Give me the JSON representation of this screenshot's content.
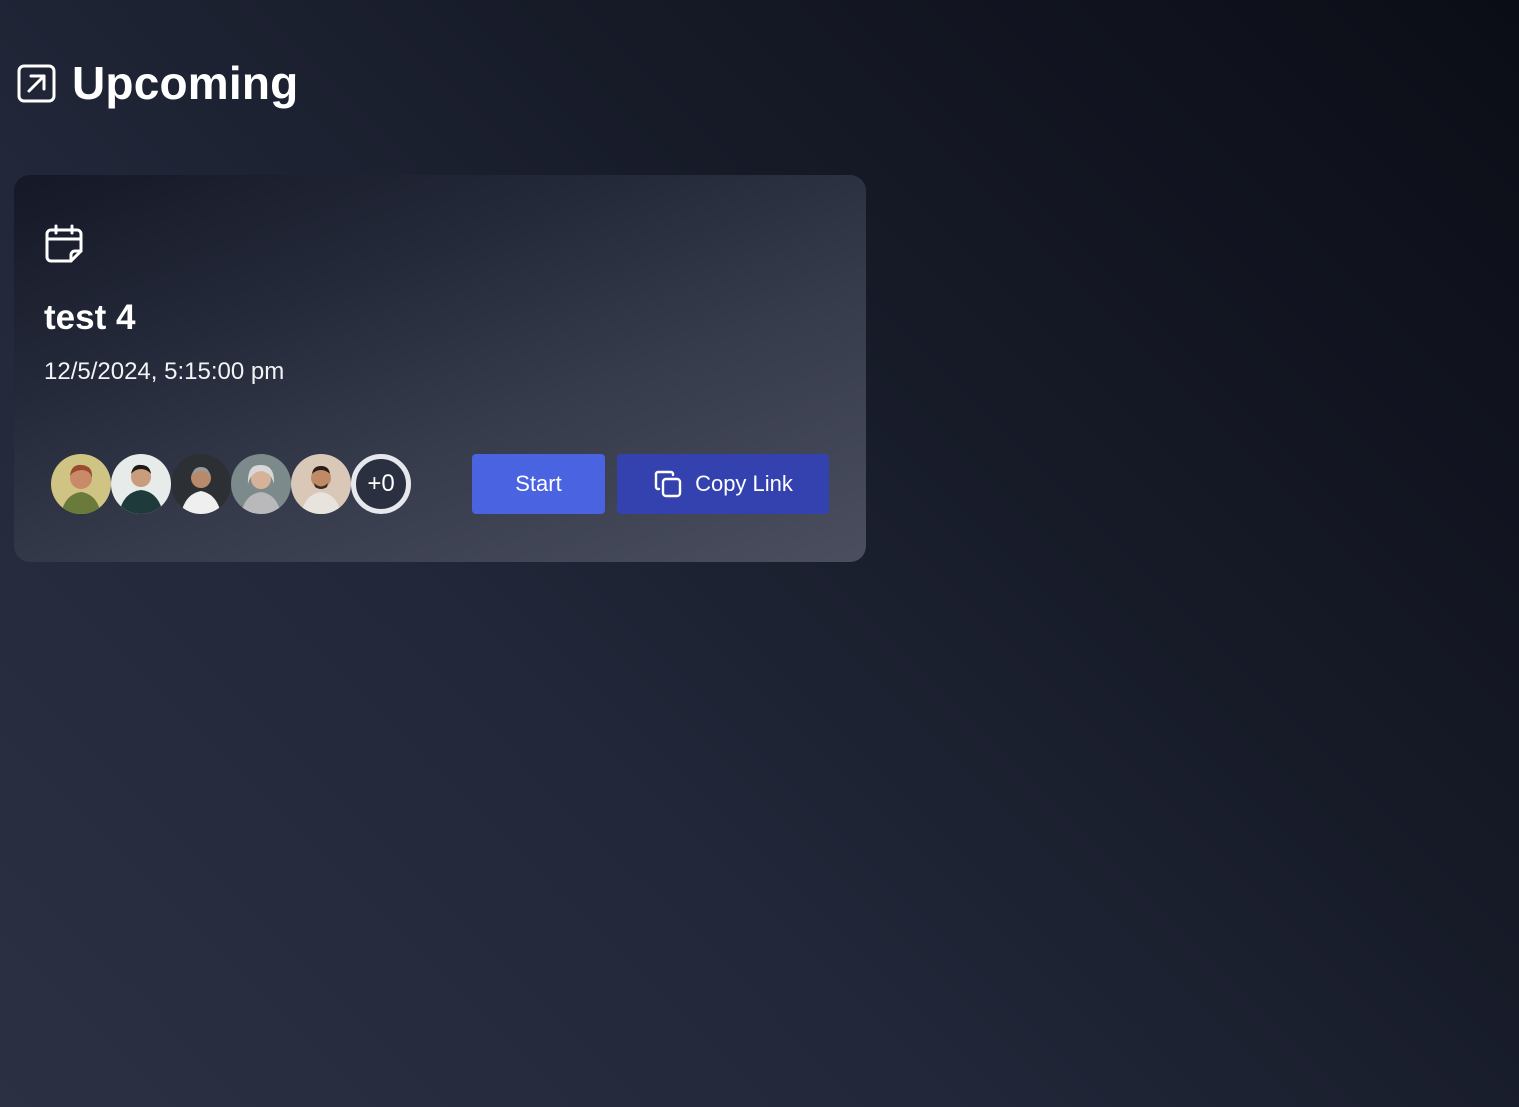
{
  "header": {
    "title": "Upcoming",
    "icon": "arrow-up-right-square-icon"
  },
  "meeting": {
    "icon": "calendar-icon",
    "title": "test 4",
    "datetime": "12/5/2024, 5:15:00 pm",
    "attendees": [
      {
        "name": "avatar-1"
      },
      {
        "name": "avatar-2"
      },
      {
        "name": "avatar-3"
      },
      {
        "name": "avatar-4"
      },
      {
        "name": "avatar-5"
      }
    ],
    "more_count": "+0",
    "start_label": "Start",
    "copy_label": "Copy Link",
    "copy_icon": "copy-icon"
  },
  "colors": {
    "primary_button": "#4a63e0",
    "secondary_button": "#3442b0"
  }
}
